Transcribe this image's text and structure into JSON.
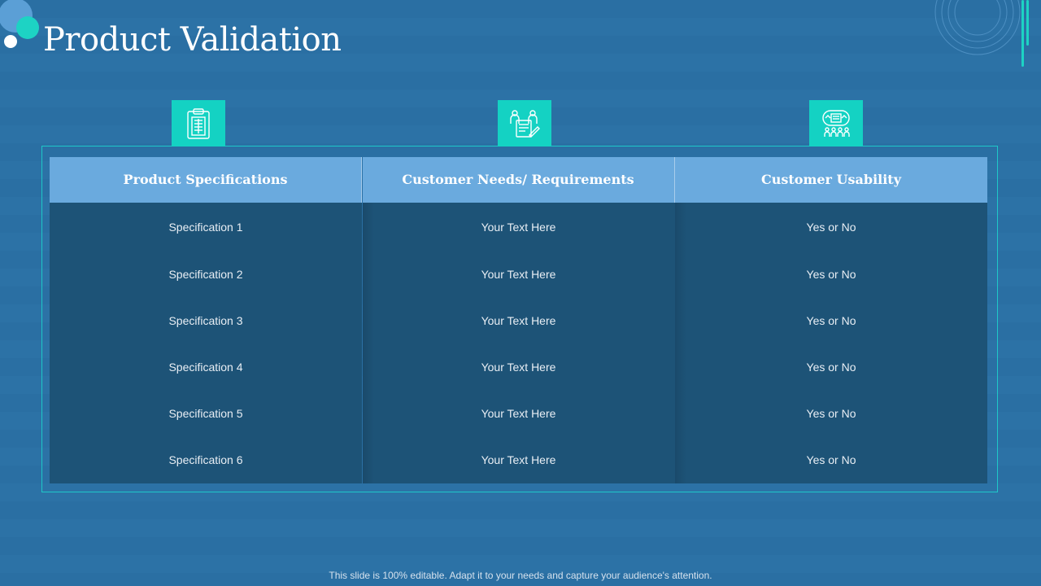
{
  "slide": {
    "title": "Product Validation",
    "footer": "This slide is 100% editable. Adapt it to your needs and capture your audience's attention."
  },
  "icons": [
    "clipboard-icon",
    "team-checklist-icon",
    "audience-presentation-icon"
  ],
  "colors": {
    "background": "#2a6fa3",
    "accent": "#14d2c3",
    "header": "#6aaade",
    "body": "#1d5377"
  },
  "table": {
    "columns": [
      {
        "header": "Product Specifications",
        "cells": [
          "Specification 1",
          "Specification 2",
          "Specification 3",
          "Specification 4",
          "Specification 5",
          "Specification 6"
        ]
      },
      {
        "header": "Customer Needs/ Requirements",
        "cells": [
          "Your Text Here",
          "Your Text Here",
          "Your Text Here",
          "Your Text Here",
          "Your Text Here",
          "Your Text Here"
        ]
      },
      {
        "header": "Customer Usability",
        "cells": [
          "Yes or No",
          "Yes or No",
          "Yes or No",
          "Yes or No",
          "Yes or No",
          "Yes or No"
        ]
      }
    ]
  }
}
